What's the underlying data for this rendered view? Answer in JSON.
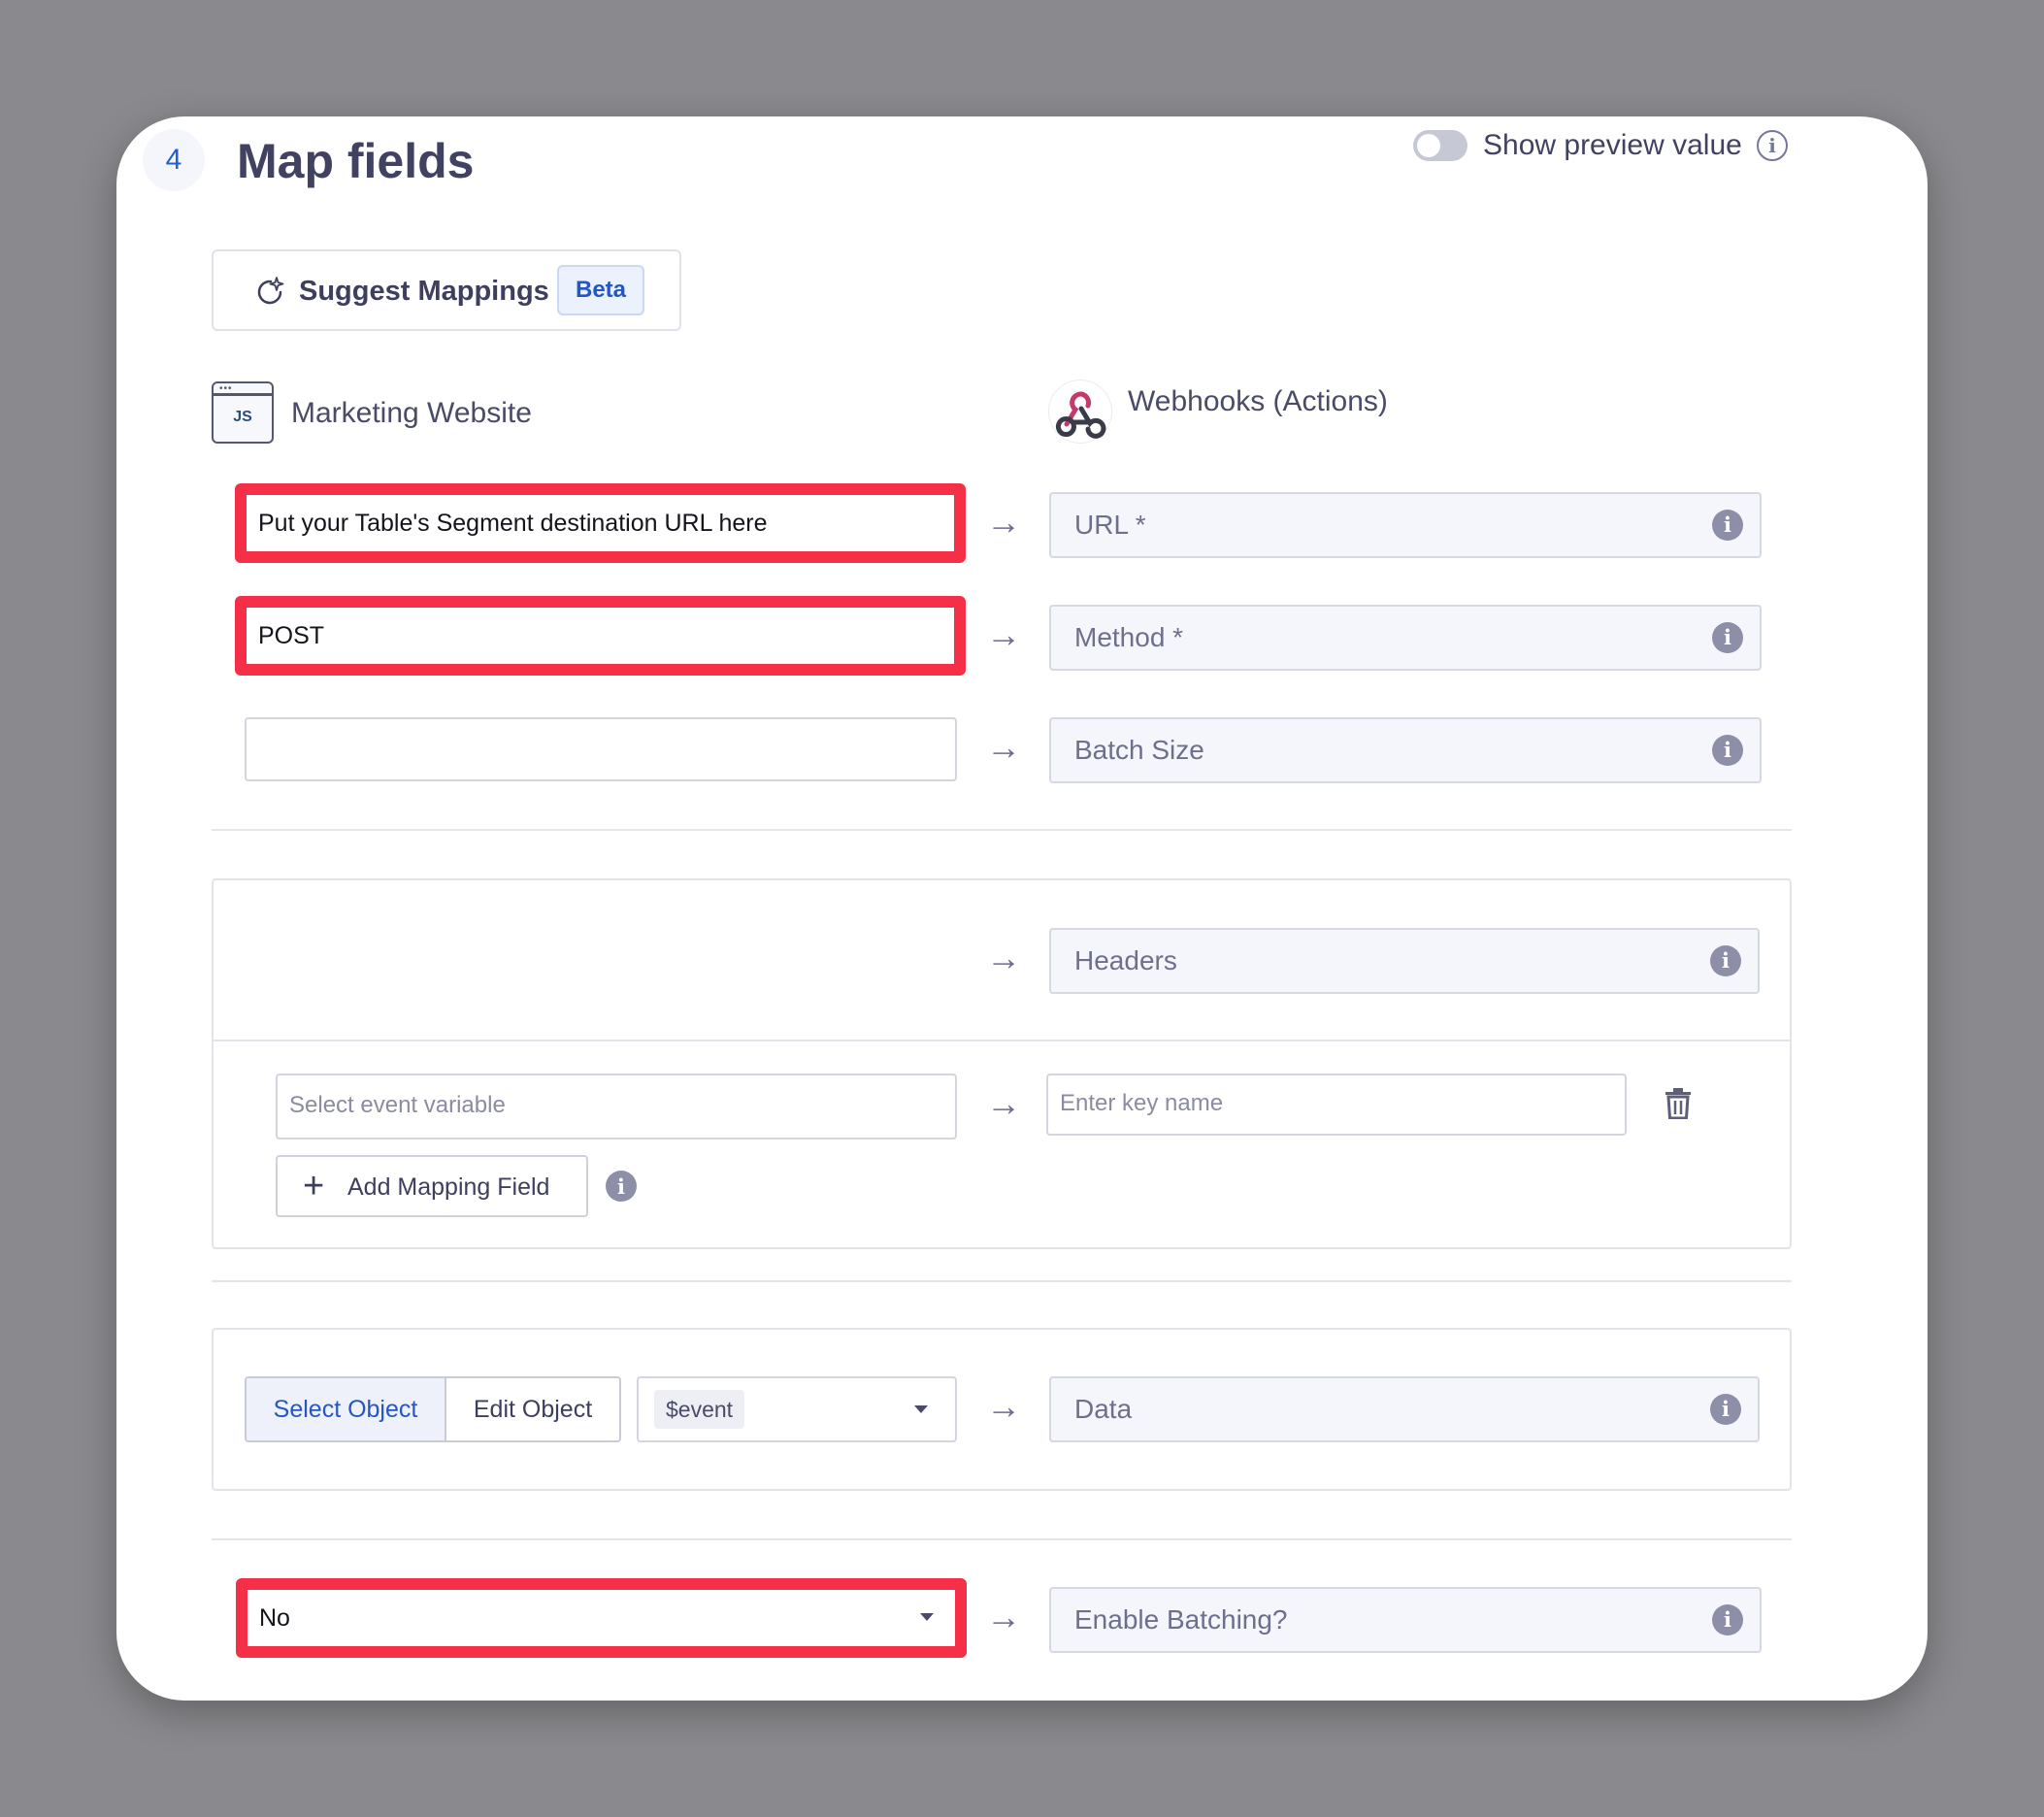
{
  "header": {
    "step_number": "4",
    "title": "Map fields",
    "preview_toggle_label": "Show preview value",
    "preview_toggle_on": false
  },
  "suggest": {
    "label": "Suggest Mappings",
    "badge": "Beta"
  },
  "source": {
    "icon_text": "JS",
    "name": "Marketing Website"
  },
  "destination": {
    "name": "Webhooks (Actions)"
  },
  "rows": [
    {
      "source_value": "Put your Table's Segment destination URL here",
      "target_label": "URL *"
    },
    {
      "source_value": "POST",
      "target_label": "Method *"
    },
    {
      "source_value": "",
      "target_label": "Batch Size"
    }
  ],
  "headers_section": {
    "target_label": "Headers",
    "variable_placeholder": "Select event variable",
    "key_placeholder": "Enter key name",
    "add_button_label": "Add Mapping Field"
  },
  "data_section": {
    "select_object_label": "Select Object",
    "edit_object_label": "Edit Object",
    "event_value": "$event",
    "target_label": "Data"
  },
  "batching": {
    "source_value": "No",
    "target_label": "Enable Batching?"
  },
  "colors": {
    "highlight": "#f52f47",
    "accent": "#2456c4",
    "background": "#8a898d"
  }
}
